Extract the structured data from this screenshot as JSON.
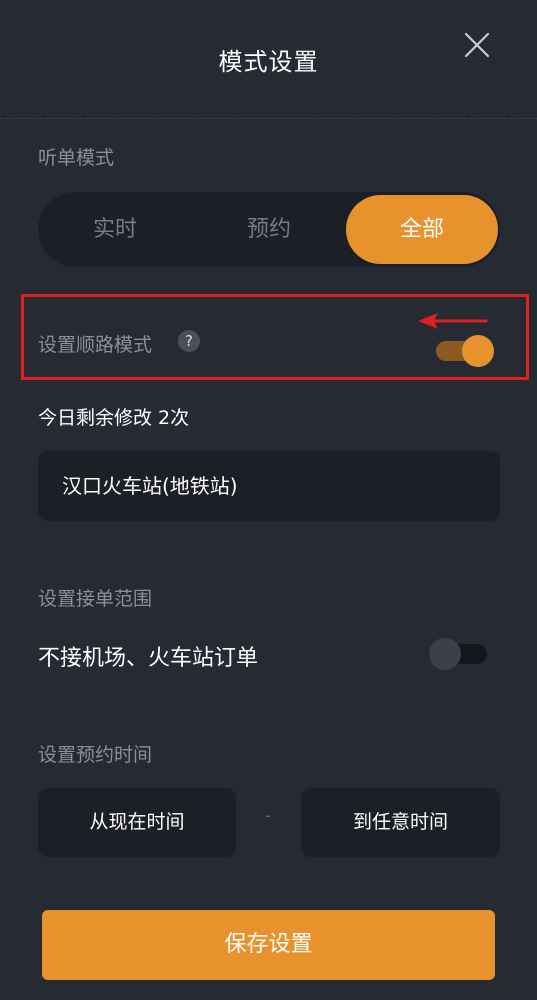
{
  "header": {
    "title": "模式设置",
    "close_icon": "close-icon"
  },
  "listen_mode": {
    "label": "听单模式",
    "options": [
      "实时",
      "预约",
      "全部"
    ],
    "selected": "全部"
  },
  "route_mode": {
    "label": "设置顺路模式",
    "help_icon_glyph": "?",
    "enabled": true,
    "remaining_text": "今日剩余修改 2次",
    "destination": "汉口火车站(地铁站)"
  },
  "range": {
    "label": "设置接单范围",
    "option_label": "不接机场、火车站订单",
    "enabled": false
  },
  "booking_time": {
    "label": "设置预约时间",
    "start": "从现在时间",
    "separator": "-",
    "end": "到任意时间"
  },
  "save_button": "保存设置",
  "colors": {
    "background": "#262a33",
    "accent": "#e8922e",
    "annotation_red": "#e02020"
  }
}
